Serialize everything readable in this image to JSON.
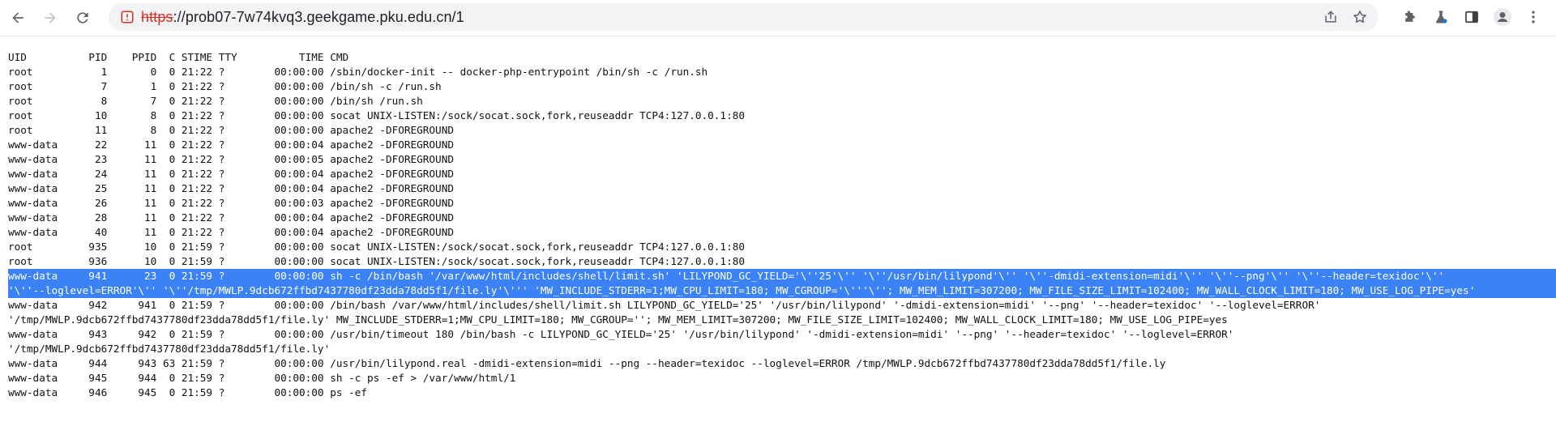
{
  "browser": {
    "url_scheme": "https",
    "url_rest": "://prob07-7w74kvq3.geekgame.pku.edu.cn/1"
  },
  "output": {
    "header": "UID          PID    PPID  C STIME TTY          TIME CMD",
    "lines": [
      {
        "text": "root           1       0  0 21:22 ?        00:00:00 /sbin/docker-init -- docker-php-entrypoint /bin/sh -c /run.sh",
        "selected": false
      },
      {
        "text": "root           7       1  0 21:22 ?        00:00:00 /bin/sh -c /run.sh",
        "selected": false
      },
      {
        "text": "root           8       7  0 21:22 ?        00:00:00 /bin/sh /run.sh",
        "selected": false
      },
      {
        "text": "root          10       8  0 21:22 ?        00:00:00 socat UNIX-LISTEN:/sock/socat.sock,fork,reuseaddr TCP4:127.0.0.1:80",
        "selected": false
      },
      {
        "text": "root          11       8  0 21:22 ?        00:00:00 apache2 -DFOREGROUND",
        "selected": false
      },
      {
        "text": "www-data      22      11  0 21:22 ?        00:00:04 apache2 -DFOREGROUND",
        "selected": false
      },
      {
        "text": "www-data      23      11  0 21:22 ?        00:00:05 apache2 -DFOREGROUND",
        "selected": false
      },
      {
        "text": "www-data      24      11  0 21:22 ?        00:00:04 apache2 -DFOREGROUND",
        "selected": false
      },
      {
        "text": "www-data      25      11  0 21:22 ?        00:00:04 apache2 -DFOREGROUND",
        "selected": false
      },
      {
        "text": "www-data      26      11  0 21:22 ?        00:00:03 apache2 -DFOREGROUND",
        "selected": false
      },
      {
        "text": "www-data      28      11  0 21:22 ?        00:00:04 apache2 -DFOREGROUND",
        "selected": false
      },
      {
        "text": "www-data      40      11  0 21:22 ?        00:00:04 apache2 -DFOREGROUND",
        "selected": false
      },
      {
        "text": "root         935      10  0 21:59 ?        00:00:00 socat UNIX-LISTEN:/sock/socat.sock,fork,reuseaddr TCP4:127.0.0.1:80",
        "selected": false
      },
      {
        "text": "root         936      10  0 21:59 ?        00:00:00 socat UNIX-LISTEN:/sock/socat.sock,fork,reuseaddr TCP4:127.0.0.1:80",
        "selected": false
      },
      {
        "text": "www-data     941      23  0 21:59 ?        00:00:00 sh -c /bin/bash '/var/www/html/includes/shell/limit.sh' 'LILYPOND_GC_YIELD='\\''25'\\'' '\\''/usr/bin/lilypond'\\'' '\\''-dmidi-extension=midi'\\'' '\\''--png'\\'' '\\''--header=texidoc'\\''",
        "selected": true
      },
      {
        "text": "'\\''--loglevel=ERROR'\\'' '\\''/tmp/MWLP.9dcb672ffbd7437780df23dda78dd5f1/file.ly'\\''' 'MW_INCLUDE_STDERR=1;MW_CPU_LIMIT=180; MW_CGROUP='\\'''\\''; MW_MEM_LIMIT=307200; MW_FILE_SIZE_LIMIT=102400; MW_WALL_CLOCK_LIMIT=180; MW_USE_LOG_PIPE=yes'",
        "selected": true
      },
      {
        "text": "www-data     942     941  0 21:59 ?        00:00:00 /bin/bash /var/www/html/includes/shell/limit.sh LILYPOND_GC_YIELD='25' '/usr/bin/lilypond' '-dmidi-extension=midi' '--png' '--header=texidoc' '--loglevel=ERROR'",
        "selected": false
      },
      {
        "text": "'/tmp/MWLP.9dcb672ffbd7437780df23dda78dd5f1/file.ly' MW_INCLUDE_STDERR=1;MW_CPU_LIMIT=180; MW_CGROUP=''; MW_MEM_LIMIT=307200; MW_FILE_SIZE_LIMIT=102400; MW_WALL_CLOCK_LIMIT=180; MW_USE_LOG_PIPE=yes",
        "selected": false
      },
      {
        "text": "www-data     943     942  0 21:59 ?        00:00:00 /usr/bin/timeout 180 /bin/bash -c LILYPOND_GC_YIELD='25' '/usr/bin/lilypond' '-dmidi-extension=midi' '--png' '--header=texidoc' '--loglevel=ERROR'",
        "selected": false
      },
      {
        "text": "'/tmp/MWLP.9dcb672ffbd7437780df23dda78dd5f1/file.ly'",
        "selected": false
      },
      {
        "text": "www-data     944     943 63 21:59 ?        00:00:00 /usr/bin/lilypond.real -dmidi-extension=midi --png --header=texidoc --loglevel=ERROR /tmp/MWLP.9dcb672ffbd7437780df23dda78dd5f1/file.ly",
        "selected": false
      },
      {
        "text": "www-data     945     944  0 21:59 ?        00:00:00 sh -c ps -ef > /var/www/html/1",
        "selected": false
      },
      {
        "text": "www-data     946     945  0 21:59 ?        00:00:00 ps -ef",
        "selected": false
      }
    ]
  },
  "icons": {
    "back": "arrow-left-icon",
    "forward": "arrow-right-icon",
    "reload": "reload-icon",
    "insecure": "not-secure-icon",
    "share": "share-icon",
    "bookmark": "star-icon",
    "extensions": "puzzle-icon",
    "labs": "flask-icon",
    "sidepanel": "side-panel-icon",
    "profile": "profile-icon",
    "menu": "kebab-menu-icon"
  },
  "colors": {
    "selection": "#3b82f6",
    "insecure_scheme": "#d93025"
  }
}
